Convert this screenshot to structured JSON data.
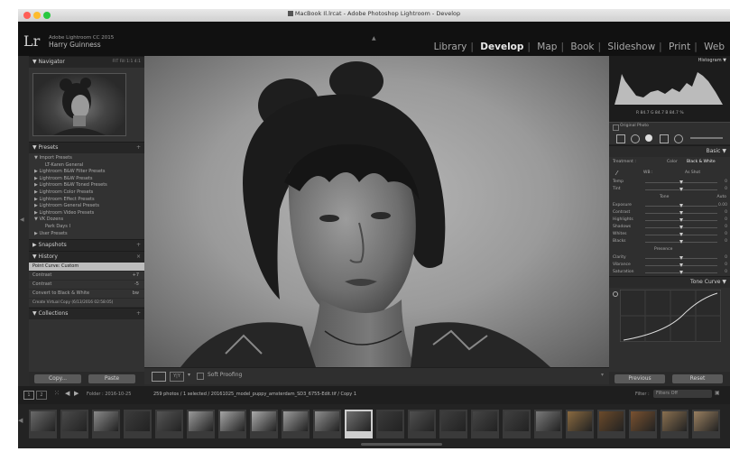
{
  "window": {
    "title": "MacBook Il.lrcat - Adobe Photoshop Lightroom - Develop",
    "traffic_colors": [
      "#ff5f57",
      "#febc2e",
      "#28c840"
    ]
  },
  "identity": {
    "logo": "Lr",
    "app_version": "Adobe Lightroom CC 2015",
    "user": "Harry Guinness"
  },
  "modules": [
    "Library",
    "Develop",
    "Map",
    "Book",
    "Slideshow",
    "Print",
    "Web"
  ],
  "left_panel": {
    "navigator": {
      "title": "Navigator",
      "zoom": "FIT  Fill  1:1  4:1"
    },
    "presets": {
      "title": "Presets",
      "items": [
        "Import Presets",
        "LT-Karen General",
        "Lightroom B&W Filter Presets",
        "Lightroom B&W Presets",
        "Lightroom B&W Toned Presets",
        "Lightroom Color Presets",
        "Lightroom Effect Presets",
        "Lightroom General Presets",
        "Lightroom Video Presets",
        "VK Dozens",
        "Park Days I",
        "User Presets"
      ]
    },
    "snapshots": {
      "title": "Snapshots"
    },
    "history": {
      "title": "History",
      "items": [
        "Point Curve: Custom",
        "Contrast",
        "Contrast",
        "Convert to Black & White",
        "Create Virtual Copy (6/13/2016 02:58:05)"
      ],
      "values": [
        "",
        "+7",
        "-5",
        "bw",
        ""
      ]
    },
    "collections": {
      "title": "Collections"
    },
    "copy_label": "Copy...",
    "paste_label": "Paste"
  },
  "toolbar": {
    "soft_proofing": "Soft Proofing"
  },
  "right_panel": {
    "histogram": {
      "title": "Histogram",
      "readout": "R 84.7  G 84.7  B 84.7 %",
      "original_label": "Original Photo"
    },
    "basic": {
      "title": "Basic",
      "treatment_label": "Treatment :",
      "color_label": "Color",
      "bw_label": "Black & White",
      "wb_label": "WB :",
      "wb_value": "As Shot",
      "tone_label": "Tone",
      "auto_label": "Auto",
      "presence_label": "Presence",
      "sliders_wb": [
        {
          "label": "Temp",
          "value": "0",
          "pos": 0.5
        },
        {
          "label": "Tint",
          "value": "0",
          "pos": 0.5
        }
      ],
      "sliders_tone": [
        {
          "label": "Exposure",
          "value": "0.00",
          "pos": 0.5
        },
        {
          "label": "Contrast",
          "value": "0",
          "pos": 0.5
        },
        {
          "label": "Highlights",
          "value": "0",
          "pos": 0.5
        },
        {
          "label": "Shadows",
          "value": "0",
          "pos": 0.5
        },
        {
          "label": "Whites",
          "value": "0",
          "pos": 0.5
        },
        {
          "label": "Blacks",
          "value": "0",
          "pos": 0.5
        }
      ],
      "sliders_presence": [
        {
          "label": "Clarity",
          "value": "0",
          "pos": 0.5
        },
        {
          "label": "Vibrance",
          "value": "0",
          "pos": 0.5
        },
        {
          "label": "Saturation",
          "value": "0",
          "pos": 0.5
        }
      ]
    },
    "tone_curve": {
      "title": "Tone Curve"
    },
    "previous_label": "Previous",
    "reset_label": "Reset"
  },
  "filmstrip": {
    "source": "Folder : 2016-10-25",
    "status": "259 photos / 1 selected / 20161025_model_puppy_amsterdam_SD3_6755-Edit.tif / Copy 1",
    "filter_label": "Filter :",
    "filter_value": "Filters Off",
    "page_numbers": [
      "1",
      "2"
    ]
  }
}
